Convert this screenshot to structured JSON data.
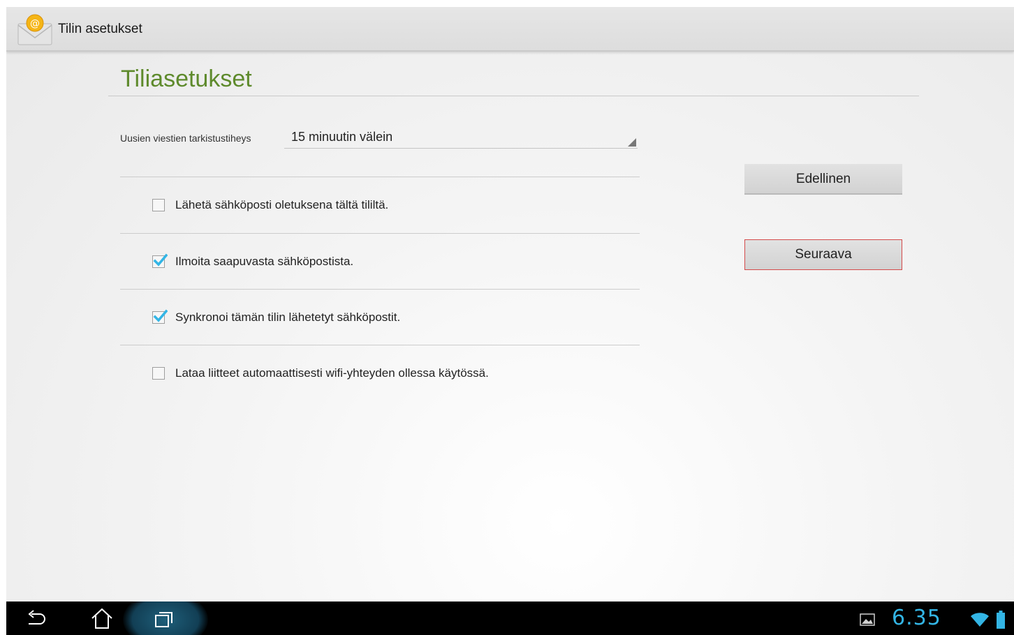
{
  "action_bar": {
    "title": "Tilin asetukset",
    "app_icon": "email-app-icon"
  },
  "main": {
    "title": "Tiliasetukset",
    "frequency": {
      "label": "Uusien viestien tarkistustiheys",
      "value": "15 minuutin välein"
    },
    "options": [
      {
        "label": "Lähetä sähköposti oletuksena tältä tililtä.",
        "checked": false
      },
      {
        "label": "Ilmoita saapuvasta sähköpostista.",
        "checked": true
      },
      {
        "label": "Synkronoi tämän tilin lähetetyt sähköpostit.",
        "checked": true
      },
      {
        "label": "Lataa liitteet automaattisesti wifi-yhteyden ollessa käytössä.",
        "checked": false
      }
    ],
    "buttons": {
      "previous": "Edellinen",
      "next": "Seuraava"
    }
  },
  "system_bar": {
    "clock": "6.35",
    "icons": [
      "back-icon",
      "home-icon",
      "recent-apps-icon",
      "gallery-notification-icon",
      "wifi-icon",
      "battery-icon"
    ]
  },
  "colors": {
    "title_green": "#5e8a2c",
    "check_blue": "#33b5e5",
    "next_button_border": "#d44a4a"
  }
}
